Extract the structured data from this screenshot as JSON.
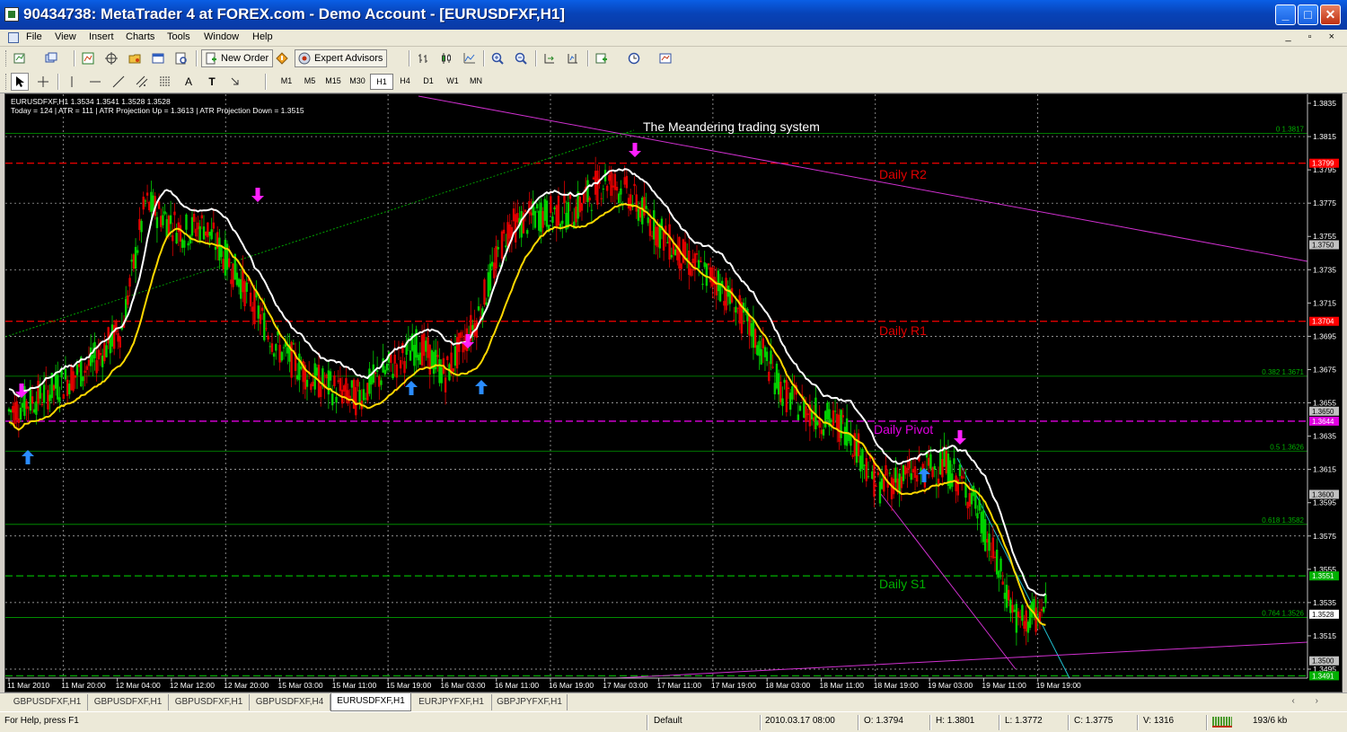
{
  "window": {
    "title": "90434738: MetaTrader 4 at FOREX.com - Demo Account - [EURUSDFXF,H1]",
    "min": "_",
    "max": "□",
    "close": "✕"
  },
  "menu": [
    "File",
    "View",
    "Insert",
    "Charts",
    "Tools",
    "Window",
    "Help"
  ],
  "mdi_controls": "_ ▫ ×",
  "toolbar": {
    "new_order": "New Order",
    "expert_advisors": "Expert Advisors"
  },
  "draw_tools": {
    "text": "A",
    "textlabel": "T"
  },
  "timeframes": [
    "M1",
    "M5",
    "M15",
    "M30",
    "H1",
    "H4",
    "D1",
    "W1",
    "MN"
  ],
  "active_timeframe": "H1",
  "chart": {
    "header": "EURUSDFXF,H1  1.3534 1.3541 1.3528 1.3528",
    "info": "Today = 124   |   ATR = 111   |   ATR Projection Up = 1.3613   |   ATR Projection Down = 1.3515",
    "system_title": "The Meandering trading system",
    "pivots": {
      "r2": "Daily R2",
      "r1": "Daily R1",
      "pivot": "Daily Pivot",
      "s1": "Daily S1"
    },
    "fib_labels": [
      "0 1.3817",
      "0.382 1.3671",
      "0.5 1.3626",
      "0.618 1.3582",
      "0.764 1.3526"
    ],
    "price_ticks": [
      "1.3835",
      "1.3815",
      "1.3795",
      "1.3775",
      "1.3755",
      "1.3735",
      "1.3715",
      "1.3695",
      "1.3675",
      "1.3655",
      "1.3635",
      "1.3615",
      "1.3595",
      "1.3575",
      "1.3555",
      "1.3535",
      "1.3515",
      "1.3495"
    ],
    "price_tags": [
      {
        "label": "1.3799",
        "bg": "#ff0000",
        "fg": "#ffffff"
      },
      {
        "label": "1.3750",
        "bg": "#c0c0c0",
        "fg": "#000000"
      },
      {
        "label": "1.3704",
        "bg": "#ff0000",
        "fg": "#ffffff"
      },
      {
        "label": "1.3650",
        "bg": "#c0c0c0",
        "fg": "#000000"
      },
      {
        "label": "1.3644",
        "bg": "#e000e0",
        "fg": "#ffffff"
      },
      {
        "label": "1.3600",
        "bg": "#c0c0c0",
        "fg": "#000000"
      },
      {
        "label": "1.3551",
        "bg": "#00b000",
        "fg": "#ffffff"
      },
      {
        "label": "1.3528",
        "bg": "#ffffff",
        "fg": "#000000"
      },
      {
        "label": "1.3500",
        "bg": "#c0c0c0",
        "fg": "#000000"
      },
      {
        "label": "1.3491",
        "bg": "#00b000",
        "fg": "#ffffff"
      }
    ],
    "time_ticks": [
      "11 Mar 2010",
      "11 Mar 20:00",
      "12 Mar 04:00",
      "12 Mar 12:00",
      "12 Mar 20:00",
      "15 Mar 03:00",
      "15 Mar 11:00",
      "15 Mar 19:00",
      "16 Mar 03:00",
      "16 Mar 11:00",
      "16 Mar 19:00",
      "17 Mar 03:00",
      "17 Mar 11:00",
      "17 Mar 19:00",
      "18 Mar 03:00",
      "18 Mar 11:00",
      "18 Mar 19:00",
      "19 Mar 03:00",
      "19 Mar 11:00",
      "19 Mar 19:00"
    ],
    "colors": {
      "bull": "#00d000",
      "bear": "#e00000",
      "ma_fast": "#ffffff",
      "ma_slow": "#ffd800",
      "pivot_r": "#e00000",
      "pivot_p": "#e000e0",
      "pivot_s": "#00a000",
      "trendline": "#d030d0",
      "arrow_buy": "#2a8cff",
      "arrow_sell": "#ff20ff"
    }
  },
  "tabs": [
    "GBPUSDFXF,H1",
    "GBPUSDFXF,H1",
    "GBPUSDFXF,H1",
    "GBPUSDFXF,H4",
    "EURUSDFXF,H1",
    "EURJPYFXF,H1",
    "GBPJPYFXF,H1"
  ],
  "active_tab": 4,
  "tab_arrows": "‹ ›",
  "status": {
    "help": "For Help, press F1",
    "profile": "Default",
    "datetime": "2010.03.17 08:00",
    "open": "O: 1.3794",
    "high": "H: 1.3801",
    "low": "L: 1.3772",
    "close": "C: 1.3775",
    "volume": "V: 1316",
    "traffic": "193/6 kb"
  }
}
